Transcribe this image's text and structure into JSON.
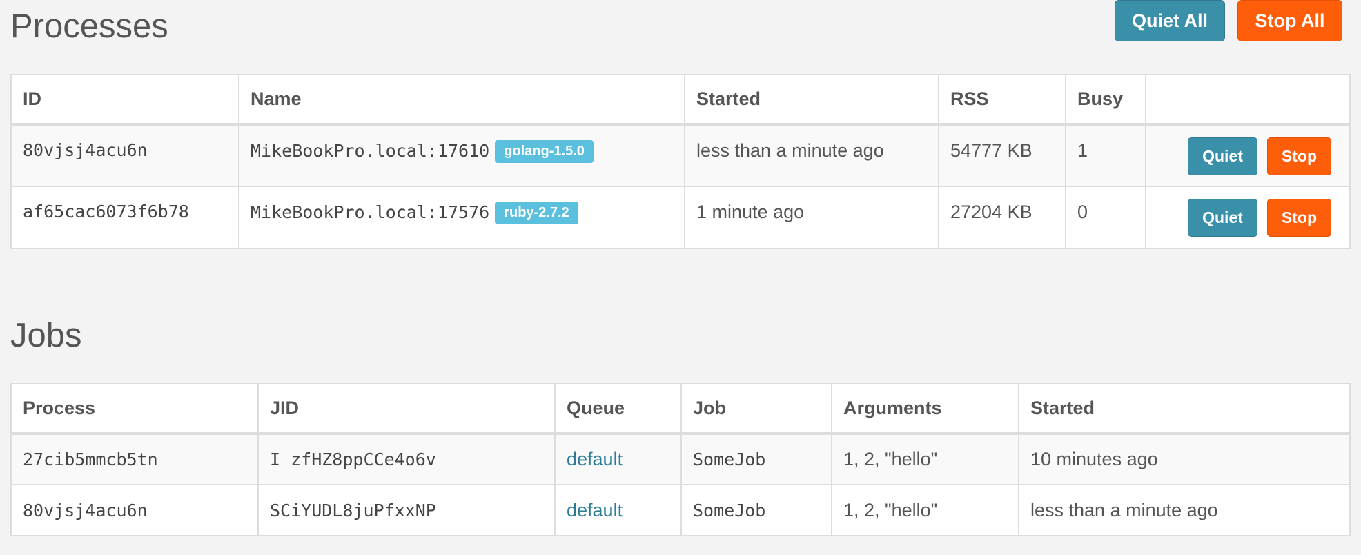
{
  "processes": {
    "title": "Processes",
    "quiet_all_label": "Quiet All",
    "stop_all_label": "Stop All",
    "columns": [
      "ID",
      "Name",
      "Started",
      "RSS",
      "Busy",
      ""
    ],
    "rows": [
      {
        "id": "80vjsj4acu6n",
        "name": "MikeBookPro.local:17610",
        "tag": "golang-1.5.0",
        "started": "less than a minute ago",
        "rss": "54777 KB",
        "busy": "1",
        "quiet_label": "Quiet",
        "stop_label": "Stop"
      },
      {
        "id": "af65cac6073f6b78",
        "name": "MikeBookPro.local:17576",
        "tag": "ruby-2.7.2",
        "started": "1 minute ago",
        "rss": "27204 KB",
        "busy": "0",
        "quiet_label": "Quiet",
        "stop_label": "Stop"
      }
    ]
  },
  "jobs": {
    "title": "Jobs",
    "columns": [
      "Process",
      "JID",
      "Queue",
      "Job",
      "Arguments",
      "Started"
    ],
    "rows": [
      {
        "process": "27cib5mmcb5tn",
        "jid": "I_zfHZ8ppCCe4o6v",
        "queue": "default",
        "job": "SomeJob",
        "arguments": "1, 2, \"hello\"",
        "started": "10 minutes ago"
      },
      {
        "process": "80vjsj4acu6n",
        "jid": "SCiYUDL8juPfxxNP",
        "queue": "default",
        "job": "SomeJob",
        "arguments": "1, 2, \"hello\"",
        "started": "less than a minute ago"
      }
    ]
  },
  "colors": {
    "primary": "#3a90a8",
    "danger": "#fe5e0a",
    "badge": "#5bc0de",
    "link": "#2a7c96"
  }
}
